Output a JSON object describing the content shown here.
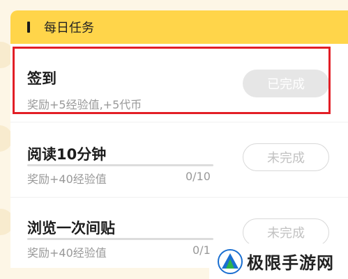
{
  "header": {
    "title": "每日任务"
  },
  "tasks": [
    {
      "title": "签到",
      "reward": "奖励+5经验值,+5代币",
      "status": "已完成"
    },
    {
      "title": "阅读10分钟",
      "reward": "奖励+40经验值",
      "progress": "0/10",
      "progress_fraction": 0,
      "status": "未完成"
    },
    {
      "title": "浏览一次间贴",
      "reward": "奖励+40经验值",
      "progress": "0/1",
      "progress_fraction": 0,
      "status": "未完成"
    }
  ],
  "watermark": {
    "text": "极限手游网"
  },
  "colors": {
    "header": "#ffd54a",
    "highlight": "#e21e26",
    "background": "#fdf6e6"
  }
}
